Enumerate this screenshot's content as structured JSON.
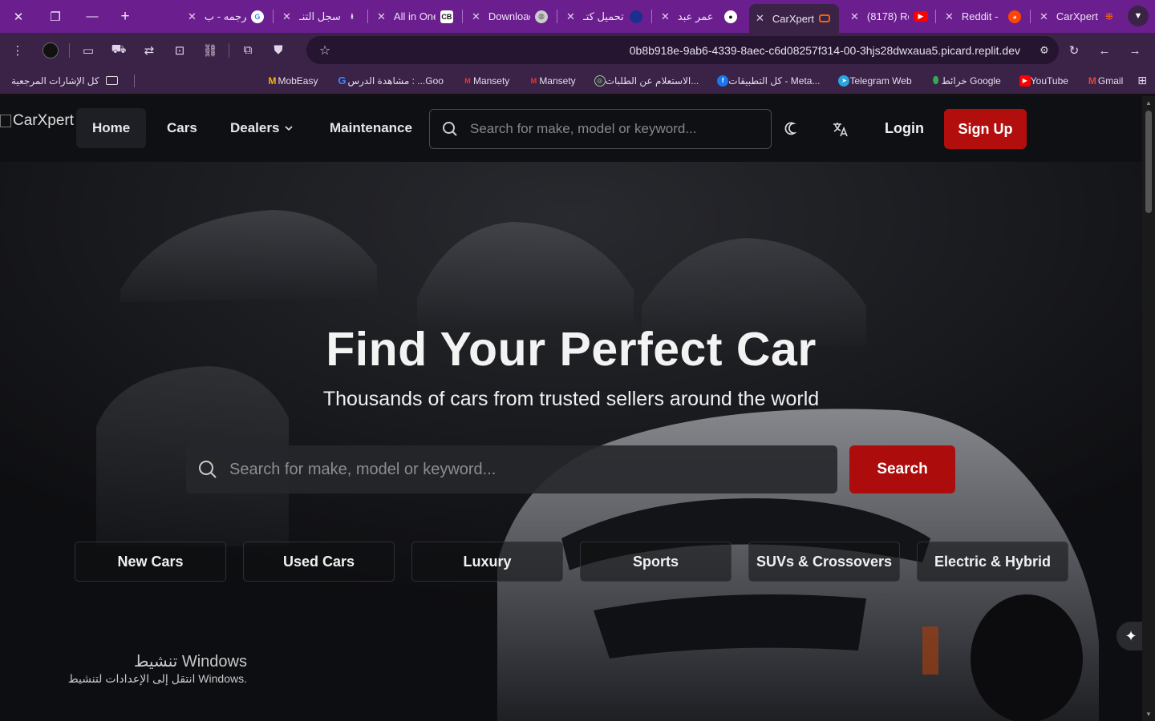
{
  "tabs": [
    {
      "title": "ترجمه - ب",
      "favicon": "google-icon"
    },
    {
      "title": "سجل التنـ",
      "favicon": "download-icon"
    },
    {
      "title": "All in One",
      "favicon": "cb-icon"
    },
    {
      "title": "Download",
      "favicon": "globe-icon"
    },
    {
      "title": "تحميل كتـ",
      "favicon": "circle-icon"
    },
    {
      "title": "عمر عبد",
      "favicon": "github-icon"
    },
    {
      "title": "CarXpert",
      "favicon": "replit-icon",
      "active": true
    },
    {
      "title": "(8178) Re",
      "favicon": "youtube-icon"
    },
    {
      "title": "Reddit -",
      "favicon": "reddit-icon"
    },
    {
      "title": "CarXpert",
      "favicon": "replit-icon"
    }
  ],
  "url": "0b8b918e-9ab6-4339-8aec-c6d08257f314-00-3hjs28dwxaua5.picard.replit.dev",
  "bookmarks": [
    {
      "label": "Gmail",
      "icon": "gmail-icon",
      "color": "#ea4335"
    },
    {
      "label": "YouTube",
      "icon": "youtube-icon",
      "color": "#ff0000"
    },
    {
      "label": "خرائط Google",
      "icon": "maps-icon",
      "color": "#34a853"
    },
    {
      "label": "Telegram Web",
      "icon": "telegram-icon",
      "color": "#2aa3df"
    },
    {
      "label": "كل التطبيقات - Meta...",
      "icon": "facebook-icon",
      "color": "#1877f2"
    },
    {
      "label": "الاستعلام عن الطلبات...",
      "icon": "gov-icon",
      "color": "#3a6b3a"
    },
    {
      "label": "Mansety",
      "icon": "mansety-icon",
      "color": "#d23"
    },
    {
      "label": "Mansety",
      "icon": "mansety-icon",
      "color": "#d23"
    },
    {
      "label": "مشاهدة الدرس : ...Goo",
      "icon": "google-icon",
      "color": "#4285f4"
    },
    {
      "label": "MobEasy",
      "icon": "mobeasy-icon",
      "color": "#f4b400"
    }
  ],
  "bookmarks_all": "كل الإشارات المرجعية",
  "site": {
    "logo_alt": "CarXpert",
    "nav": {
      "home": "Home",
      "cars": "Cars",
      "dealers": "Dealers",
      "maintenance": "Maintenance"
    },
    "nav_search_placeholder": "Search for make, model or keyword...",
    "login": "Login",
    "signup": "Sign Up",
    "accent": "#b30e0e"
  },
  "hero": {
    "title": "Find Your Perfect Car",
    "subtitle": "Thousands of cars from trusted sellers around the world",
    "search_placeholder": "Search for make, model or keyword...",
    "search_button": "Search",
    "categories": [
      "New Cars",
      "Used Cars",
      "Luxury",
      "Sports",
      "SUVs & Crossovers",
      "Electric & Hybrid"
    ]
  },
  "windows_activation": {
    "title": "تنشيط Windows",
    "subtitle": "انتقل إلى الإعدادات لتنشيط Windows."
  }
}
